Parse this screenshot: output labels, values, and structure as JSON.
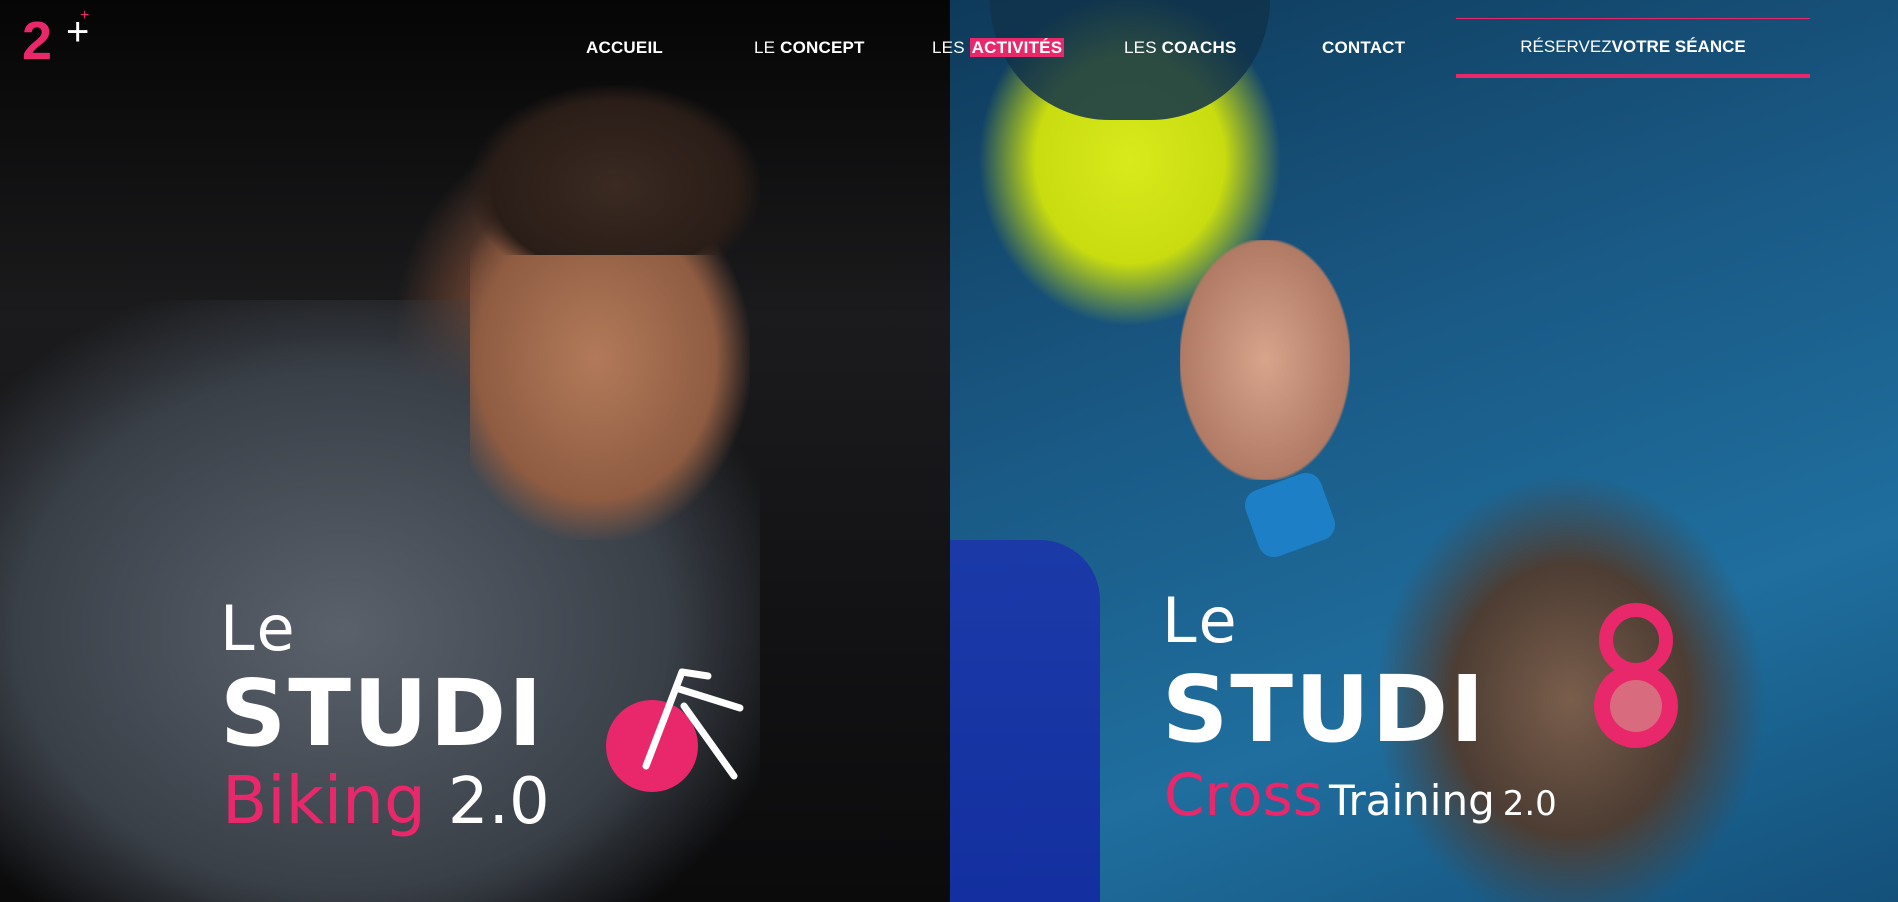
{
  "brand": {
    "logo_main": "2",
    "logo_plus": "+",
    "logo_small_plus": "+"
  },
  "nav": {
    "accueil": "ACCUEIL",
    "concept": {
      "light": "LE ",
      "bold": "CONCEPT"
    },
    "activites": {
      "light": "LES ",
      "bold": "ACTIVITÉS"
    },
    "coachs": {
      "light": "LES ",
      "bold": "COACHS"
    },
    "contact": "CONTACT",
    "cta": {
      "light": "RÉSERVEZ ",
      "bold": "VOTRE SÉANCE"
    }
  },
  "colors": {
    "accent": "#e8286b",
    "text": "#ffffff"
  },
  "cards": {
    "biking": {
      "le": "Le",
      "studio": "STUDI",
      "name": "Biking",
      "version": "2.0",
      "icon": "bike-icon"
    },
    "cross": {
      "le": "Le",
      "studio": "STUDI",
      "name": "Cross",
      "name2": "Training",
      "version": "2.0",
      "icon": "kettlebell-icon"
    }
  }
}
